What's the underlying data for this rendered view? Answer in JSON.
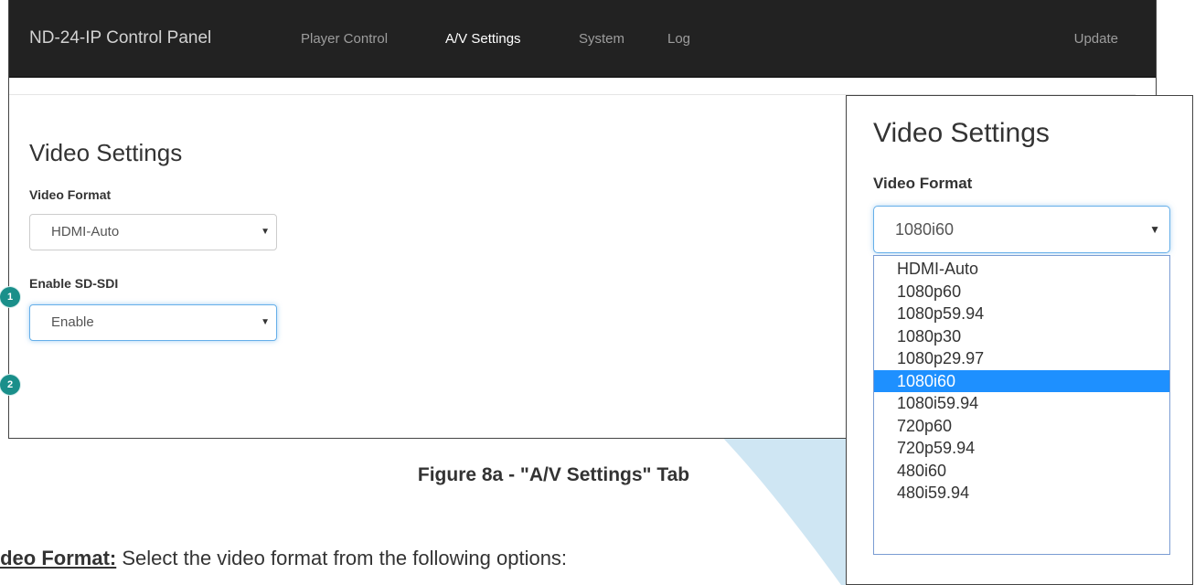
{
  "navbar": {
    "brand": "ND-24-IP Control Panel",
    "links": [
      "Player Control",
      "A/V Settings",
      "System",
      "Log"
    ],
    "active": "A/V Settings",
    "update": "Update"
  },
  "page": {
    "title": "Video Settings",
    "video_format_label": "Video Format",
    "video_format_value": "HDMI-Auto",
    "sdsdi_label": "Enable SD-SDI",
    "sdsdi_value": "Enable"
  },
  "badges": [
    "1",
    "2"
  ],
  "inset": {
    "title": "Video Settings",
    "label": "Video Format",
    "value": "1080i60",
    "options": [
      "HDMI-Auto",
      "1080p60",
      "1080p59.94",
      "1080p30",
      "1080p29.97",
      "1080i60",
      "1080i59.94",
      "720p60",
      "720p59.94",
      "480i60",
      "480i59.94"
    ],
    "selected": "1080i60"
  },
  "caption": "Figure 8a - \"A/V Settings\" Tab",
  "body": {
    "term": "ideo Format:",
    "text": " Select the video format from the following options:"
  },
  "colors": {
    "navbar": "#222222",
    "focus": "#66afe9",
    "selected_option": "#1e90ff",
    "badge": "#1a8f8a",
    "callout": "#cde6f3"
  }
}
